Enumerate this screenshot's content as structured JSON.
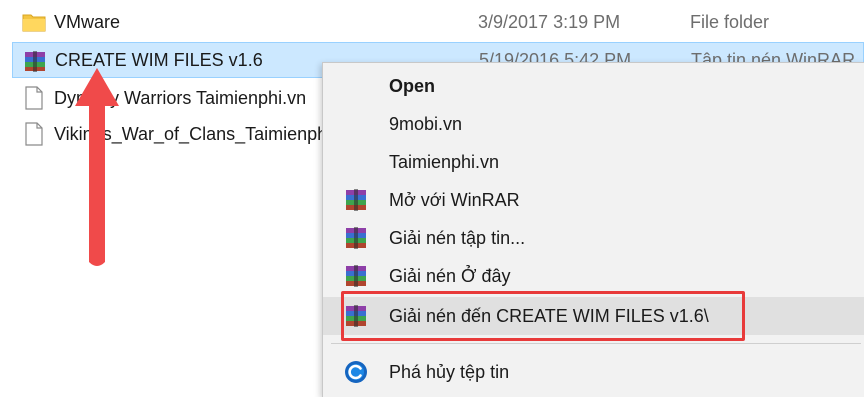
{
  "files": [
    {
      "name": "VMware",
      "date": "3/9/2017 3:19 PM",
      "type": "File folder",
      "icon": "folder-icon"
    },
    {
      "name": "CREATE WIM FILES v1.6",
      "date": "5/19/2016 5:42 PM",
      "type": "Tập tin nén WinRAR",
      "icon": "winrar-archive-icon",
      "selected": true
    },
    {
      "name": "Dynasty Warriors Taimienphi.vn",
      "date": "",
      "type": "",
      "icon": "document-icon"
    },
    {
      "name": "Vikings_War_of_Clans_Taimienphi.vn",
      "date": "",
      "type": "",
      "icon": "document-icon"
    }
  ],
  "context_menu": {
    "items": [
      {
        "label": "Open",
        "icon": "",
        "bold": true
      },
      {
        "label": "9mobi.vn",
        "icon": ""
      },
      {
        "label": "Taimienphi.vn",
        "icon": ""
      },
      {
        "label": "Mở với WinRAR",
        "icon": "winrar-icon"
      },
      {
        "label": "Giải nén tập tin...",
        "icon": "winrar-icon"
      },
      {
        "label": "Giải nén Ở đây",
        "icon": "winrar-icon"
      },
      {
        "label": "Giải nén đến CREATE WIM FILES v1.6\\",
        "icon": "winrar-icon",
        "highlighted": true
      },
      {
        "label": "Phá hủy tệp tin",
        "icon": "ccleaner-icon"
      }
    ]
  },
  "colors": {
    "selection_bg": "#cce8ff",
    "highlight_border": "#e83a3a",
    "arrow": "#f04a4a",
    "menu_bg": "#f2f2f2"
  }
}
